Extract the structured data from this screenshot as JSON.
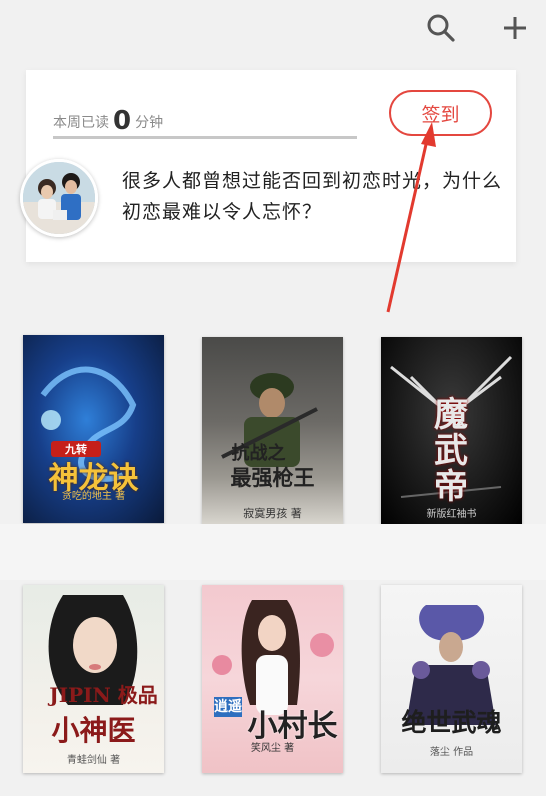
{
  "header": {
    "search_icon": "search-icon",
    "add_icon": "plus-icon"
  },
  "reading_card": {
    "prefix": "本周已读",
    "minutes": "0",
    "suffix": "分钟",
    "signin_label": "签到",
    "message": "很多人都曾想过能否回到初恋时光，为什么初恋最难以令人忘怀？",
    "accent_color": "#e4473f"
  },
  "books": [
    {
      "title_top": "九转",
      "title": "神龙诀",
      "author": "贪吃的地主 著"
    },
    {
      "title_top": "抗战之",
      "title": "最强枪王",
      "author": "寂寞男孩 著"
    },
    {
      "title_top": "",
      "title": "魔武帝",
      "author": "新版红袖书"
    },
    {
      "title_top": "JIPIN 极品",
      "title": "小神医",
      "author": "青蛙剑仙 著"
    },
    {
      "title_top": "逍遥",
      "title": "小村长",
      "author": "笑风尘 著"
    },
    {
      "title_top": "",
      "title": "绝世武魂",
      "author": "落尘 作品"
    }
  ]
}
